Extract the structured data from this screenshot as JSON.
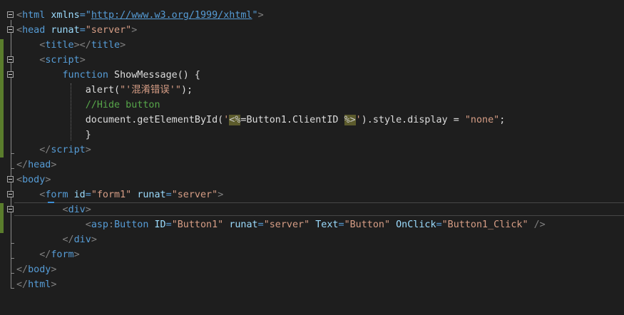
{
  "editor": {
    "lines": [
      {
        "tokens": [
          {
            "c": "p",
            "t": "<"
          },
          {
            "c": "t",
            "t": "html"
          },
          {
            "c": "txt",
            "t": " "
          },
          {
            "c": "a",
            "t": "xmlns"
          },
          {
            "c": "t",
            "t": "=\""
          },
          {
            "c": "u",
            "t": "http://www.w3.org/1999/xhtml"
          },
          {
            "c": "t",
            "t": "\""
          },
          {
            "c": "p",
            "t": ">"
          }
        ]
      },
      {
        "tokens": [
          {
            "c": "p",
            "t": "<"
          },
          {
            "c": "t",
            "t": "head"
          },
          {
            "c": "txt",
            "t": " "
          },
          {
            "c": "a",
            "t": "runat"
          },
          {
            "c": "t",
            "t": "="
          },
          {
            "c": "v",
            "t": "\"server\""
          },
          {
            "c": "p",
            "t": ">"
          }
        ]
      },
      {
        "tokens": [
          {
            "c": "txt",
            "t": "    "
          },
          {
            "c": "p",
            "t": "<"
          },
          {
            "c": "t",
            "t": "title"
          },
          {
            "c": "p",
            "t": "></"
          },
          {
            "c": "t",
            "t": "title"
          },
          {
            "c": "p",
            "t": ">"
          }
        ]
      },
      {
        "tokens": [
          {
            "c": "txt",
            "t": "    "
          },
          {
            "c": "p",
            "t": "<"
          },
          {
            "c": "t",
            "t": "script"
          },
          {
            "c": "p",
            "t": ">"
          }
        ]
      },
      {
        "tokens": [
          {
            "c": "txt",
            "t": "        "
          },
          {
            "c": "k",
            "t": "function"
          },
          {
            "c": "txt",
            "t": " ShowMessage() {"
          }
        ]
      },
      {
        "tokens": [
          {
            "c": "txt",
            "t": "            alert("
          },
          {
            "c": "s",
            "t": "\"'混淆错误'\""
          },
          {
            "c": "txt",
            "t": ");"
          }
        ]
      },
      {
        "tokens": [
          {
            "c": "txt",
            "t": "            "
          },
          {
            "c": "c",
            "t": "//Hide button"
          }
        ]
      },
      {
        "tokens": [
          {
            "c": "txt",
            "t": "            document.getElementById("
          },
          {
            "c": "s",
            "t": "'"
          },
          {
            "c": "asp",
            "t": "<%"
          },
          {
            "c": "txt",
            "t": "=Button1.ClientID "
          },
          {
            "c": "asp",
            "t": "%>"
          },
          {
            "c": "s",
            "t": "'"
          },
          {
            "c": "txt",
            "t": ").style.display = "
          },
          {
            "c": "s",
            "t": "\"none\""
          },
          {
            "c": "txt",
            "t": ";"
          }
        ]
      },
      {
        "tokens": [
          {
            "c": "txt",
            "t": "            }"
          }
        ]
      },
      {
        "tokens": [
          {
            "c": "txt",
            "t": "    "
          },
          {
            "c": "p",
            "t": "</"
          },
          {
            "c": "t",
            "t": "script"
          },
          {
            "c": "p",
            "t": ">"
          }
        ]
      },
      {
        "tokens": [
          {
            "c": "p",
            "t": "</"
          },
          {
            "c": "t",
            "t": "head"
          },
          {
            "c": "p",
            "t": ">"
          }
        ]
      },
      {
        "tokens": [
          {
            "c": "p",
            "t": "<"
          },
          {
            "c": "t",
            "t": "body"
          },
          {
            "c": "p",
            "t": ">"
          }
        ]
      },
      {
        "tokens": [
          {
            "c": "txt",
            "t": "    "
          },
          {
            "c": "p",
            "t": "<"
          },
          {
            "c": "t",
            "t": "form"
          },
          {
            "c": "txt",
            "t": " "
          },
          {
            "c": "a",
            "t": "id"
          },
          {
            "c": "t",
            "t": "="
          },
          {
            "c": "v",
            "t": "\"form1\""
          },
          {
            "c": "txt",
            "t": " "
          },
          {
            "c": "a",
            "t": "runat"
          },
          {
            "c": "t",
            "t": "="
          },
          {
            "c": "v",
            "t": "\"server\""
          },
          {
            "c": "p",
            "t": ">"
          }
        ]
      },
      {
        "tokens": [
          {
            "c": "txt",
            "t": "        "
          },
          {
            "c": "p",
            "t": "<"
          },
          {
            "c": "t",
            "t": "div"
          },
          {
            "c": "p",
            "t": ">"
          }
        ]
      },
      {
        "tokens": [
          {
            "c": "txt",
            "t": "            "
          },
          {
            "c": "p",
            "t": "<"
          },
          {
            "c": "t",
            "t": "asp"
          },
          {
            "c": "p",
            "t": ":"
          },
          {
            "c": "t",
            "t": "Button"
          },
          {
            "c": "txt",
            "t": " "
          },
          {
            "c": "a",
            "t": "ID"
          },
          {
            "c": "t",
            "t": "="
          },
          {
            "c": "v",
            "t": "\"Button1\""
          },
          {
            "c": "txt",
            "t": " "
          },
          {
            "c": "a",
            "t": "runat"
          },
          {
            "c": "t",
            "t": "="
          },
          {
            "c": "v",
            "t": "\"server\""
          },
          {
            "c": "txt",
            "t": " "
          },
          {
            "c": "a",
            "t": "Text"
          },
          {
            "c": "t",
            "t": "="
          },
          {
            "c": "v",
            "t": "\"Button\""
          },
          {
            "c": "txt",
            "t": " "
          },
          {
            "c": "a",
            "t": "OnClick"
          },
          {
            "c": "t",
            "t": "="
          },
          {
            "c": "v",
            "t": "\"Button1_Click\""
          },
          {
            "c": "txt",
            "t": " "
          },
          {
            "c": "p",
            "t": "/>"
          }
        ]
      },
      {
        "tokens": [
          {
            "c": "txt",
            "t": "        "
          },
          {
            "c": "p",
            "t": "</"
          },
          {
            "c": "t",
            "t": "div"
          },
          {
            "c": "p",
            "t": ">"
          }
        ]
      },
      {
        "tokens": [
          {
            "c": "txt",
            "t": "    "
          },
          {
            "c": "p",
            "t": "</"
          },
          {
            "c": "t",
            "t": "form"
          },
          {
            "c": "p",
            "t": ">"
          }
        ]
      },
      {
        "tokens": [
          {
            "c": "p",
            "t": "</"
          },
          {
            "c": "t",
            "t": "body"
          },
          {
            "c": "p",
            "t": ">"
          }
        ]
      },
      {
        "tokens": [
          {
            "c": "p",
            "t": "</"
          },
          {
            "c": "t",
            "t": "html"
          },
          {
            "c": "p",
            "t": ">"
          }
        ]
      }
    ]
  }
}
